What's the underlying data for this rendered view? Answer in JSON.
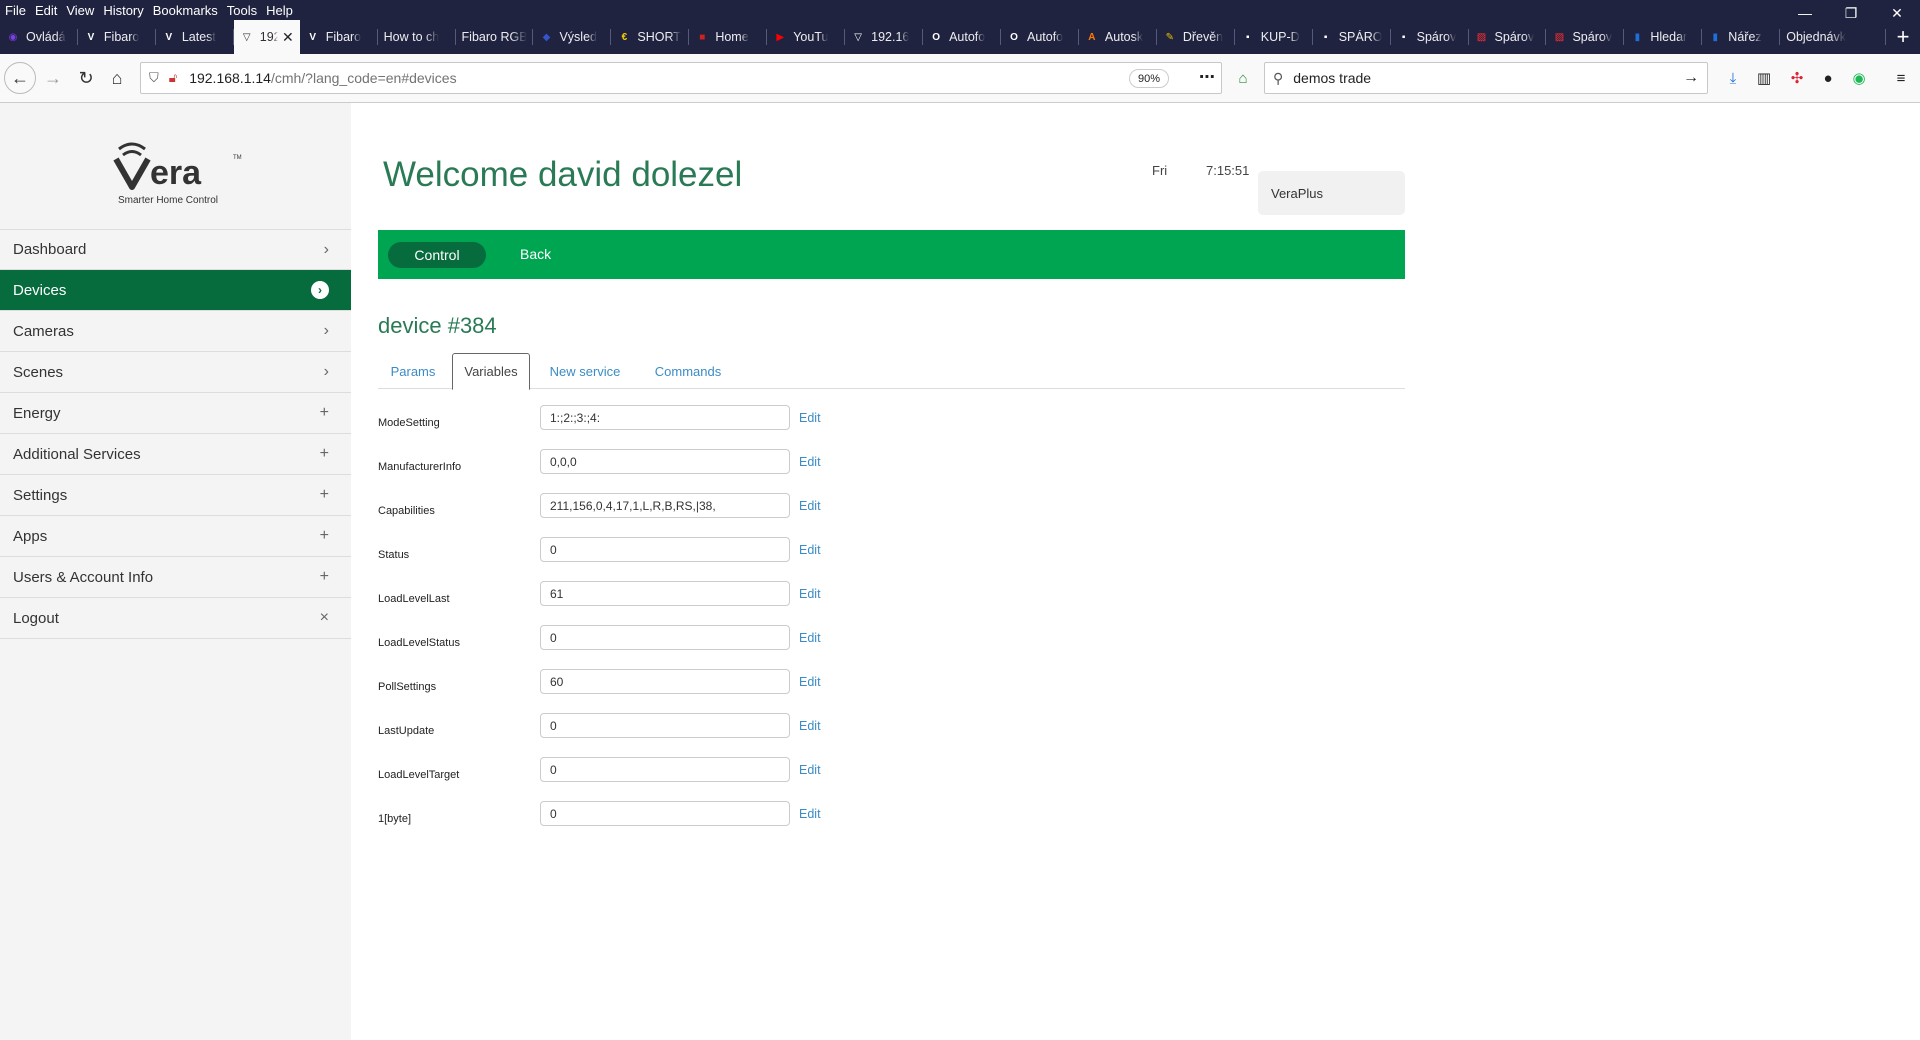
{
  "browser": {
    "menu": [
      "File",
      "Edit",
      "View",
      "History",
      "Bookmarks",
      "Tools",
      "Help"
    ],
    "window_controls": [
      "—",
      "❐",
      "✕"
    ],
    "tabs": [
      {
        "label": "Ovládá",
        "favicon_color": "#7b3fe4",
        "glyph": "◉"
      },
      {
        "label": "Fibaro",
        "favicon_color": "#ffffff",
        "glyph": "V"
      },
      {
        "label": "Latest",
        "favicon_color": "#ffffff",
        "glyph": "V"
      },
      {
        "label": "192",
        "favicon_color": "#ffffff",
        "glyph": "▽",
        "active": true
      },
      {
        "label": "Fibaro",
        "favicon_color": "#ffffff",
        "glyph": "V"
      },
      {
        "label": "How to ch",
        "favicon_color": "",
        "glyph": ""
      },
      {
        "label": "Fibaro RGB",
        "favicon_color": "",
        "glyph": ""
      },
      {
        "label": "Výsled",
        "favicon_color": "#3355cc",
        "glyph": "◆"
      },
      {
        "label": "SHORT",
        "favicon_color": "#f5d000",
        "glyph": "€"
      },
      {
        "label": "Home",
        "favicon_color": "#cc2222",
        "glyph": "■"
      },
      {
        "label": "YouTu",
        "favicon_color": "#ff0000",
        "glyph": "▶"
      },
      {
        "label": "192.16",
        "favicon_color": "",
        "glyph": "▽"
      },
      {
        "label": "Autofo",
        "favicon_color": "#ffffff",
        "glyph": "O"
      },
      {
        "label": "Autofo",
        "favicon_color": "#ffffff",
        "glyph": "O"
      },
      {
        "label": "Autosk",
        "favicon_color": "#ff7a00",
        "glyph": "A"
      },
      {
        "label": "Dřevěn",
        "favicon_color": "#e8c000",
        "glyph": "✎"
      },
      {
        "label": "KUP-D",
        "favicon_color": "#ffffff",
        "glyph": "▪"
      },
      {
        "label": "SPÁRO",
        "favicon_color": "#ffffff",
        "glyph": "▪"
      },
      {
        "label": "Spárov",
        "favicon_color": "#ffffff",
        "glyph": "▪"
      },
      {
        "label": "Spárov",
        "favicon_color": "#ff3030",
        "glyph": "▨"
      },
      {
        "label": "Spárov",
        "favicon_color": "#ff3030",
        "glyph": "▨"
      },
      {
        "label": "Hledar",
        "favicon_color": "#1e6fd9",
        "glyph": "▮"
      },
      {
        "label": "Nářez",
        "favicon_color": "#1e6fd9",
        "glyph": "▮"
      },
      {
        "label": "Objednávk",
        "favicon_color": "",
        "glyph": ""
      }
    ],
    "url_host": "192.168.1.14",
    "url_path": "/cmh/?lang_code=en#devices",
    "zoom": "90%",
    "search_value": "demos trade"
  },
  "sidebar": {
    "logo_text": "Vera",
    "logo_tagline": "Smarter Home Control",
    "items": [
      {
        "label": "Dashboard",
        "indicator": "›"
      },
      {
        "label": "Devices",
        "indicator": "›",
        "active": true
      },
      {
        "label": "Cameras",
        "indicator": "›"
      },
      {
        "label": "Scenes",
        "indicator": "›"
      },
      {
        "label": "Energy",
        "indicator": "+"
      },
      {
        "label": "Additional Services",
        "indicator": "+"
      },
      {
        "label": "Settings",
        "indicator": "+"
      },
      {
        "label": "Apps",
        "indicator": "+"
      },
      {
        "label": "Users & Account Info",
        "indicator": "+"
      },
      {
        "label": "Logout",
        "indicator": "×"
      }
    ]
  },
  "header": {
    "welcome": "Welcome david dolezel",
    "day": "Fri",
    "time": "7:15:51",
    "unit": "VeraPlus"
  },
  "toolbar": {
    "control_label": "Control",
    "back_label": "Back"
  },
  "device": {
    "title": "device #384",
    "tabs": [
      "Params",
      "Variables",
      "New service",
      "Commands"
    ],
    "active_tab": "Variables",
    "edit_label": "Edit",
    "variables": [
      {
        "name": "ModeSetting",
        "value": "1:;2:;3:;4:"
      },
      {
        "name": "ManufacturerInfo",
        "value": "0,0,0"
      },
      {
        "name": "Capabilities",
        "value": "211,156,0,4,17,1,L,R,B,RS,|38,"
      },
      {
        "name": "Status",
        "value": "0"
      },
      {
        "name": "LoadLevelLast",
        "value": "61"
      },
      {
        "name": "LoadLevelStatus",
        "value": "0"
      },
      {
        "name": "PollSettings",
        "value": "60"
      },
      {
        "name": "LastUpdate",
        "value": "0"
      },
      {
        "name": "LoadLevelTarget",
        "value": "0"
      },
      {
        "name": "1[byte]",
        "value": "0"
      }
    ]
  }
}
